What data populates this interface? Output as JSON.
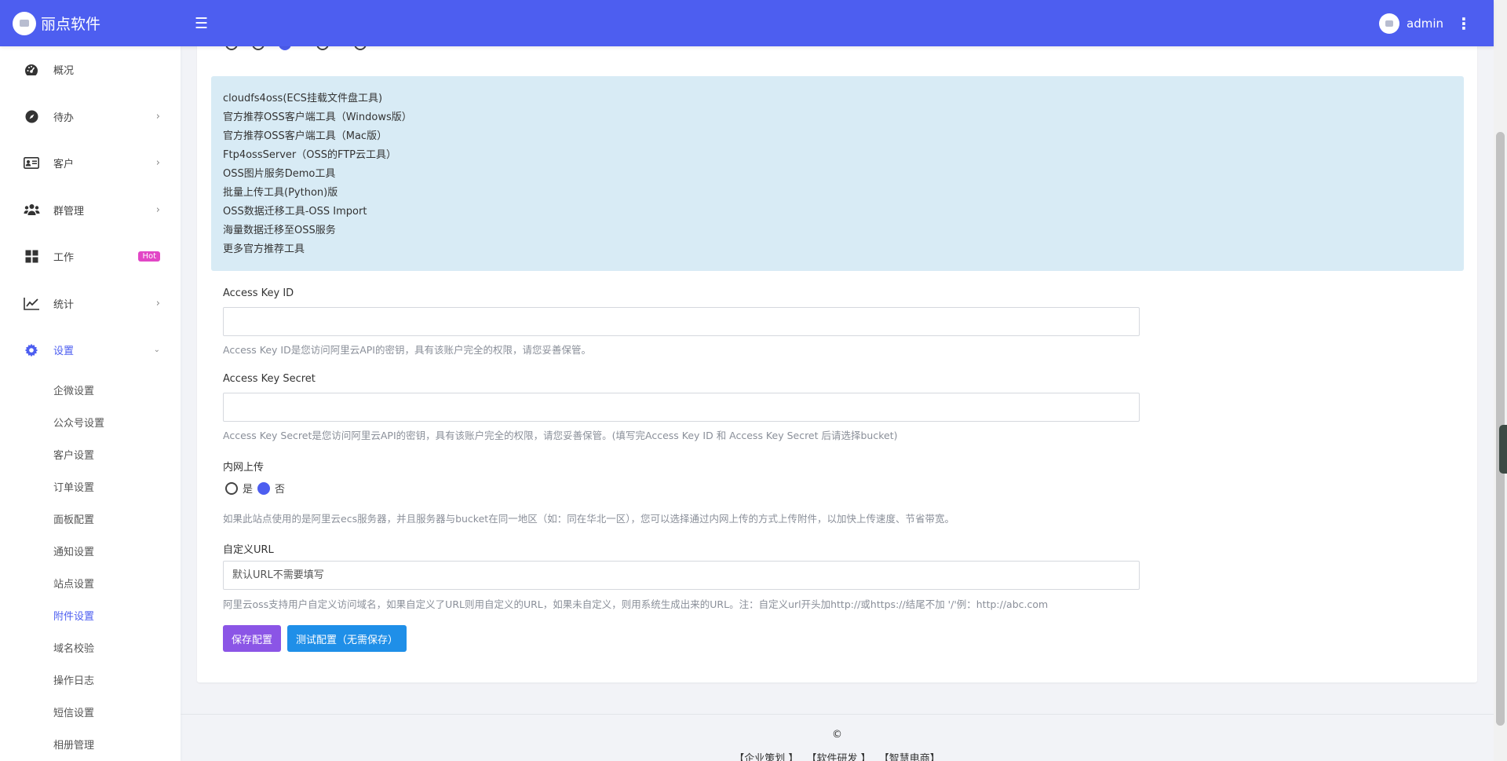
{
  "app": {
    "brand": "丽点软件",
    "user": "admin"
  },
  "sidebar": {
    "items": [
      {
        "label": "概况",
        "icon": "gauge-icon"
      },
      {
        "label": "待办",
        "icon": "compass-icon"
      },
      {
        "label": "客户",
        "icon": "id-card-icon"
      },
      {
        "label": "群管理",
        "icon": "users-icon"
      },
      {
        "label": "工作",
        "icon": "grid-icon",
        "badge": "Hot"
      },
      {
        "label": "统计",
        "icon": "chart-line-icon"
      },
      {
        "label": "设置",
        "icon": "gear-icon"
      }
    ],
    "sub_items": [
      "企微设置",
      "公众号设置",
      "客户设置",
      "订单设置",
      "面板配置",
      "通知设置",
      "站点设置",
      "附件设置",
      "域名校验",
      "操作日志",
      "短信设置",
      "相册管理"
    ]
  },
  "storage_options": [
    {
      "label": "",
      "checked": false
    },
    {
      "label": "",
      "checked": false
    },
    {
      "label": "",
      "checked": true,
      "tag": ""
    },
    {
      "label": "",
      "checked": false,
      "tag": ""
    },
    {
      "label": "",
      "checked": false,
      "tag": ""
    }
  ],
  "tools": [
    "cloudfs4oss(ECS挂载文件盘工具)",
    "官方推荐OSS客户端工具（Windows版）",
    "官方推荐OSS客户端工具（Mac版）",
    "Ftp4ossServer（OSS的FTP云工具）",
    "OSS图片服务Demo工具",
    "批量上传工具(Python)版",
    "OSS数据迁移工具-OSS Import",
    "海量数据迁移至OSS服务",
    "更多官方推荐工具"
  ],
  "form": {
    "access_key_id": {
      "label": "Access Key ID",
      "value": "",
      "help": "Access Key ID是您访问阿里云API的密钥，具有该账户完全的权限，请您妥善保管。"
    },
    "access_key_secret": {
      "label": "Access Key Secret",
      "value": "",
      "help": "Access Key Secret是您访问阿里云API的密钥，具有该账户完全的权限，请您妥善保管。(填写完Access Key ID 和 Access Key Secret 后请选择bucket)"
    },
    "intranet": {
      "label": "内网上传",
      "options": [
        {
          "label": "是",
          "checked": false
        },
        {
          "label": "否",
          "checked": true
        }
      ],
      "help": "如果此站点使用的是阿里云ecs服务器，并且服务器与bucket在同一地区（如：同在华北一区），您可以选择通过内网上传的方式上传附件，以加快上传速度、节省带宽。"
    },
    "custom_url": {
      "label": "自定义URL",
      "placeholder": "默认URL不需要填写",
      "help": "阿里云oss支持用户自定义访问域名，如果自定义了URL则用自定义的URL，如果未自定义，则用系统生成出来的URL。注：自定义url开头加http://或https://结尾不加 '/'例：http://abc.com"
    }
  },
  "buttons": {
    "save": "保存配置",
    "test": "测试配置（无需保存）"
  },
  "footer": {
    "copyright": "©",
    "links": [
      "【企业策划 】",
      "【软件研发 】",
      "【智慧电商】"
    ]
  },
  "colors": {
    "primary": "#4d5ef0",
    "info_bg": "#d8ebf5",
    "hot_badge": "#e246c6",
    "save_button": "#8b55e6",
    "test_button": "#1f8fe8"
  }
}
